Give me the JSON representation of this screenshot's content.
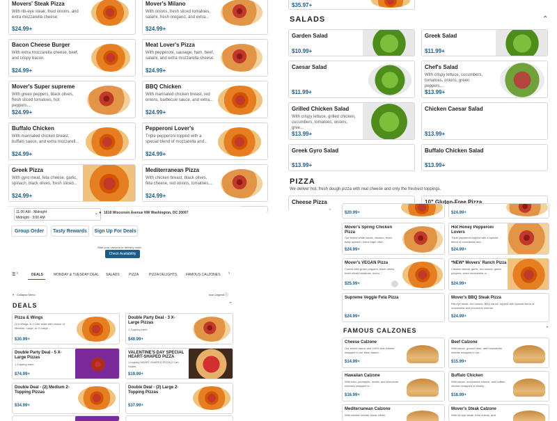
{
  "top_left": [
    {
      "title": "Movers' Steak Pizza",
      "desc": "With rib-eye steak, fried onions, and extra mozzarella cheese.",
      "price": "$24.99+"
    },
    {
      "title": "Mover's Milano",
      "desc": "With onions, fresh sliced tomatoes, salami, fresh oregano, and extra...",
      "price": "$24.99+"
    },
    {
      "title": "Bacon Cheese Burger",
      "desc": "With extra mozzarella cheese, beef, and crispy bacon.",
      "price": "$24.99+"
    },
    {
      "title": "Meat Lover's Pizza",
      "desc": "With pepperoni, sausage, ham, beef, salami, and extra mozzarella cheese.",
      "price": "$24.99+"
    },
    {
      "title": "Mover's Super supreme",
      "desc": "With green peppers, black olives, fresh sliced tomatoes, hot peppers,...",
      "price": "$24.99+"
    },
    {
      "title": "BBQ Chicken",
      "desc": "With marinated chicken breast, red onions, barbecue sauce, and extra...",
      "price": "$24.99+"
    },
    {
      "title": "Buffalo Chicken",
      "desc": "With marinated chicken breast, buffalo sauce, and extra mozzarell...",
      "price": "$24.99+"
    },
    {
      "title": "Pepperoni Lover's",
      "desc": "Triple pepperoni topped with a special blend of mozzarella and...",
      "price": "$24.99+"
    },
    {
      "title": "Greek Pizza",
      "desc": "With gyro meat, feta cheese, garlic, spinach, black olives, fresh sliced...",
      "price": "$24.99+"
    },
    {
      "title": "Mediterranean Pizza",
      "desc": "With chicken breast, black olives, feta cheese, red onions, tomatoes,...",
      "price": "$24.99+"
    }
  ],
  "top_right_price": "$35.97+",
  "salads": {
    "header": "SALADS",
    "items": [
      {
        "title": "Garden Salad",
        "desc": "",
        "price": "$10.99+"
      },
      {
        "title": "Greek Salad",
        "desc": "",
        "price": "$11.99+"
      },
      {
        "title": "Caesar Salad",
        "desc": "",
        "price": "$11.99+"
      },
      {
        "title": "Chef's Salad",
        "desc": "With crispy lettuce, cucumbers, tomatoes, onions, green peppers,...",
        "price": "$13.99+"
      },
      {
        "title": "Grilled Chicken Salad",
        "desc": "With crispy lettuce, grilled chicken, cucumbers, tomatoes, onions, gree...",
        "price": "$13.99+"
      },
      {
        "title": "Chicken Caesar Salad",
        "desc": "",
        "price": "$13.99+"
      },
      {
        "title": "Greek Gyro Salad",
        "desc": "",
        "price": "$13.99+"
      },
      {
        "title": "Buffalo Chicken Salad",
        "desc": "",
        "price": "$13.99+"
      }
    ]
  },
  "pizza_section": {
    "header": "PIZZA",
    "sub": "We deliver hot, fresh dough pizza with real cheese and only the freshest toppings.",
    "items": [
      {
        "title": "Cheese Pizza"
      },
      {
        "title": "10\" Gluten-Free Pizza"
      }
    ]
  },
  "inner": {
    "hours": [
      "11:00 AM - Midnight",
      "Midnight - 3:00 AM"
    ],
    "address": "1618 Wisconsin Avenue NW Washington, DC 20007",
    "buttons": [
      "Group Order",
      "Tasty Rewards",
      "Sign Up For Deals"
    ],
    "availability_text": "Start your carryout or delivery order.",
    "availability_btn": "Check Availability",
    "tabs": [
      "DEALS",
      "MONDAY & TUESDAY DEAL",
      "SALADS",
      "PIZZA",
      "PIZZA DELIGHTS",
      "FAMOUS CALZONES"
    ],
    "collapse": "Collapse Menu",
    "icon_legend": "Icon Legend",
    "deals_header": "DEALS",
    "deals": [
      {
        "title": "Pizza & Wings",
        "desc": "(10) Wings, & 2-Liter soda with choice of Medium, Large, or X-Large...",
        "price": "$30.99+"
      },
      {
        "title": "Double Party Deal - 3 X-Large Pizzas",
        "desc": "1-Topping each.",
        "price": "$49.99+"
      },
      {
        "title": "Double Party Deal - 5 X-Large Pizzas",
        "desc": "1-Topping each.",
        "price": "$74.99+"
      },
      {
        "title": "VALENTINE'S DAY SPECIAL HEART-SHAPED PIZZA",
        "desc": "1 topping HEART-SHAPED PIZZA 2 Can Sodas",
        "price": "$19.99+"
      },
      {
        "title": "Double Deal - (2) Medium 2-Topping Pizzas",
        "desc": "",
        "price": "$34.99+"
      },
      {
        "title": "Double Deal - (2) Large 2-Topping Pizzas",
        "desc": "",
        "price": "$37.99+"
      }
    ],
    "right_prices": [
      "$20.99+",
      "$24.99+"
    ],
    "right_items": [
      {
        "title": "Mover's Spring Chicken Pizza",
        "desc": "Our secret white sauce, chicken, fresh baby spinach, extra virgin olive...",
        "price": "$24.99+"
      },
      {
        "title": "Hot Honey Pepperoni Lovers",
        "desc": "Triple pepperoni topped with a special blend of mozzarella and...",
        "price": "$24.99+"
      },
      {
        "title": "Mover's VEGAN Pizza",
        "desc": "Comes with green peppers, black olives, fresh sliced tomatoes, onion...",
        "price": "$25.99+"
      },
      {
        "title": "*NEW* Movers' Ranch Pizza",
        "desc": "Chicken breast, garlic, red onions, green peppers, extra mozzarella, a...",
        "price": "$24.99+"
      },
      {
        "title": "Supreme Veggie Feta Pizza",
        "desc": "",
        "price": "$24.99+"
      },
      {
        "title": "Mover's BBQ Steak Pizza",
        "desc": "Rib-eye steak, red onions, BBQ sauce, topped with special blend of mozzarella and provolone cheese.",
        "price": "$24.99+"
      }
    ],
    "calzones_header": "FAMOUS CALZONES",
    "calzones": [
      {
        "title": "Cheese Calzone",
        "desc": "Our secret sauce and 100% real cheese wrapped in our fresh baked...",
        "price": "$14.99+"
      },
      {
        "title": "Beef Calzone",
        "desc": "With sauce, ground beef, and mozzarella cheese wrapped in our...",
        "price": "$15.99+"
      },
      {
        "title": "Hawaiian Calzone",
        "desc": "With ham, pineapple, ricotta, and provolone cheeses wrapped in...",
        "price": "$16.99+"
      },
      {
        "title": "Buffalo Chicken",
        "desc": "With sauce, mozzarella cheese, and buffalo chicken wrapped in freshly...",
        "price": "$18.99+"
      },
      {
        "title": "Mediterranean Calzone",
        "desc": "With chicken breast, black olives,",
        "price": ""
      },
      {
        "title": "Mover's Steak Calzone",
        "desc": "With rib-eye steak, fried onions, and",
        "price": ""
      }
    ]
  }
}
